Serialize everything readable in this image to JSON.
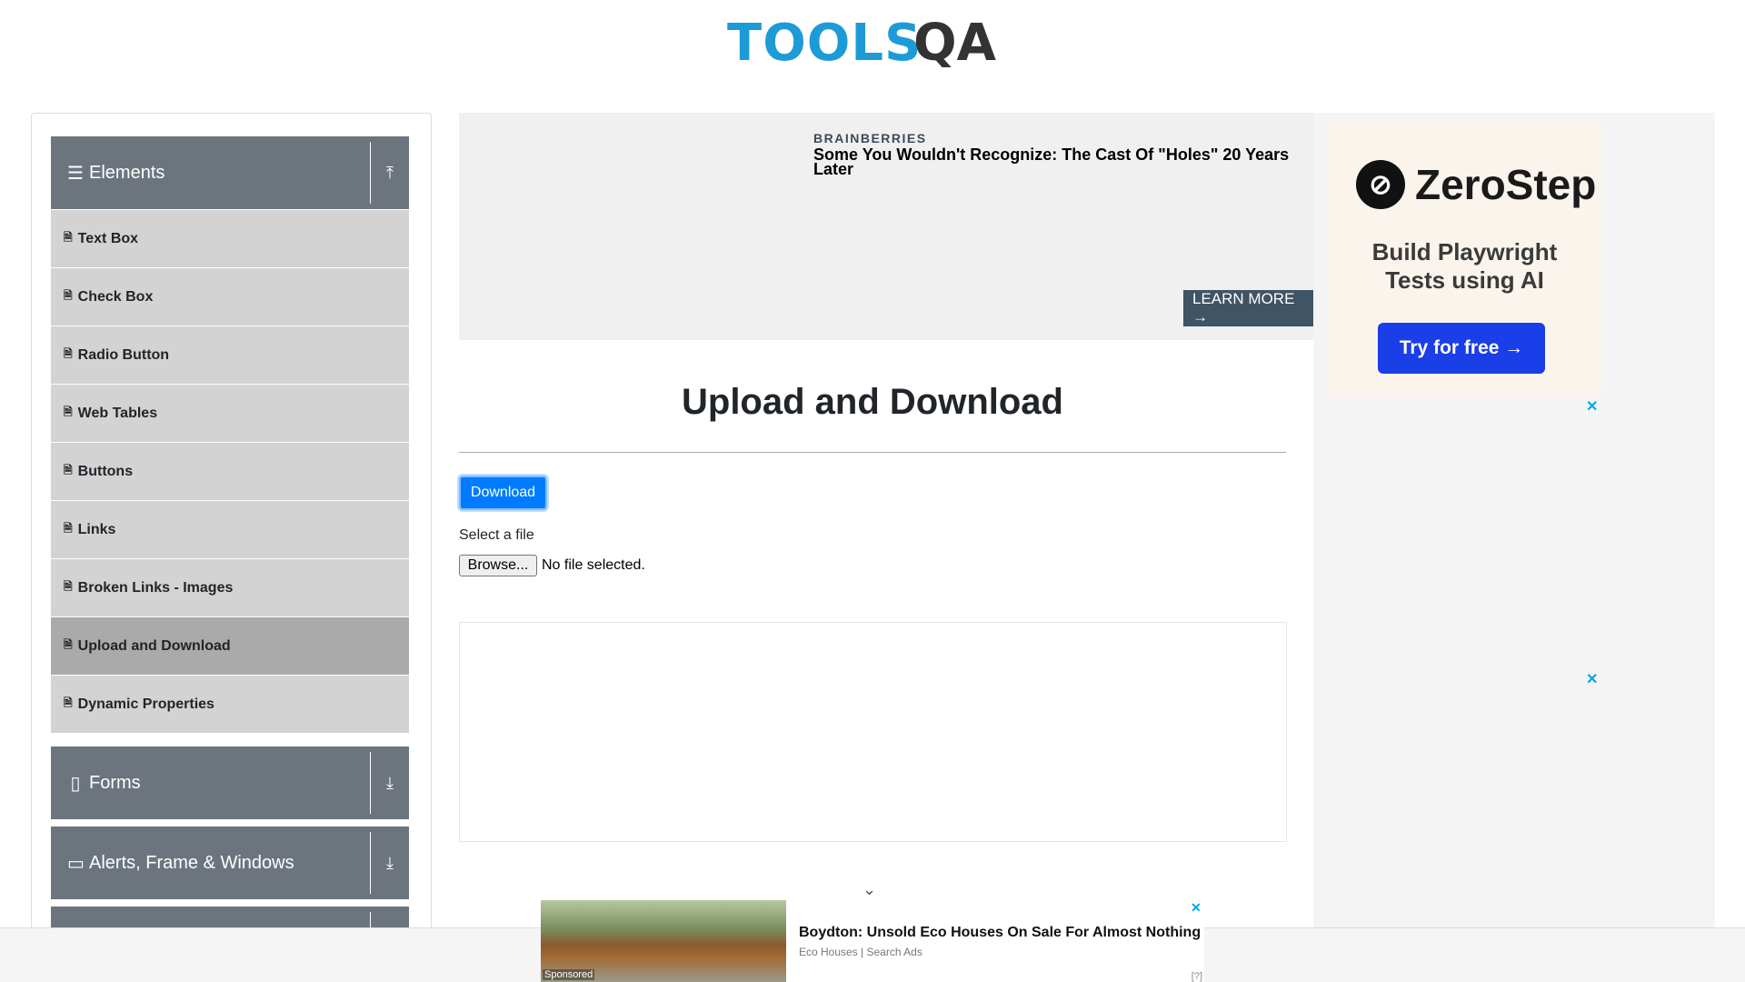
{
  "header": {
    "logo_text": "TOOLS",
    "logo_accent": "QA"
  },
  "sidebar": {
    "elements": {
      "icon": "hamburger-icon",
      "title": "Elements",
      "toggle_icon": "collapse-up-icon",
      "items": [
        {
          "label": "Text Box"
        },
        {
          "label": "Check Box"
        },
        {
          "label": "Radio Button"
        },
        {
          "label": "Web Tables"
        },
        {
          "label": "Buttons"
        },
        {
          "label": "Links"
        },
        {
          "label": "Broken Links - Images"
        },
        {
          "label": "Upload and Download",
          "active": true
        },
        {
          "label": "Dynamic Properties"
        }
      ]
    },
    "forms": {
      "title": "Forms",
      "toggle_icon": "expand-down-icon"
    },
    "alerts": {
      "title": "Alerts, Frame & Windows",
      "toggle_icon": "expand-down-icon"
    }
  },
  "top_ad": {
    "brand": "BRAINBERRIES",
    "headline": "Some You Wouldn't Recognize: The Cast Of \"Holes\" 20 Years Later",
    "cta": "LEARN MORE →"
  },
  "main": {
    "title": "Upload and Download",
    "download_label": "Download",
    "select_label": "Select a file",
    "browse_label": "Browse...",
    "file_status": "No file selected."
  },
  "right_ad": {
    "brand": "ZeroStep",
    "tagline_line1": "Build Playwright",
    "tagline_line2": "Tests using AI",
    "cta": "Try for free →",
    "close": "✕"
  },
  "bottom_ad": {
    "sponsored": "Sponsored",
    "headline": "Boydton: Unsold Eco Houses On Sale For Almost Nothing",
    "source": "Eco Houses | Search Ads",
    "info": "[?]",
    "close": "✕"
  },
  "colors": {
    "accent_blue": "#007bff",
    "sidebar_header": "#6c757d",
    "menu_item": "#d3d3d3",
    "logo_blue": "#1d9bd6"
  }
}
